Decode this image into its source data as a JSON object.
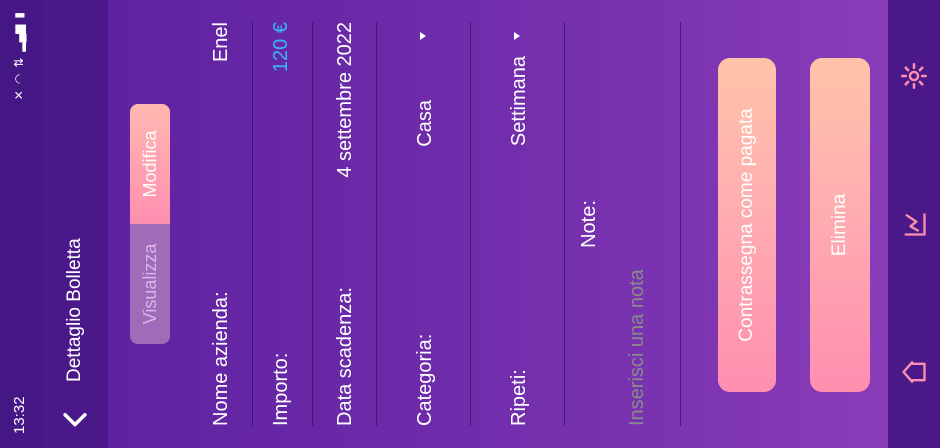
{
  "status": {
    "time": "13:32"
  },
  "header": {
    "title": "Dettaglio Bolletta"
  },
  "mode_toggle": {
    "left": "Visualizza",
    "right": "Modifica"
  },
  "fields": {
    "company_label": "Nome azienda:",
    "company_value": "Enel",
    "amount_label": "Importo:",
    "amount_value": "120 €",
    "due_label": "Data scadenza:",
    "due_value": "4 settembre 2022",
    "category_label": "Categoria:",
    "category_value": "Casa",
    "repeat_label": "Ripeti:",
    "repeat_value": "Settimana",
    "notes_label": "Note:",
    "notes_placeholder": "Inserisci una nota"
  },
  "actions": {
    "mark_paid": "Contrassegna come pagata",
    "delete": "Elimina"
  },
  "nav": {
    "icons": [
      "home-icon",
      "chart-icon",
      "gear-icon"
    ]
  },
  "colors": {
    "accent_pink": "#ff8fb0",
    "accent_peach": "#ffc3a8",
    "amount_blue": "#3ab8f0"
  }
}
